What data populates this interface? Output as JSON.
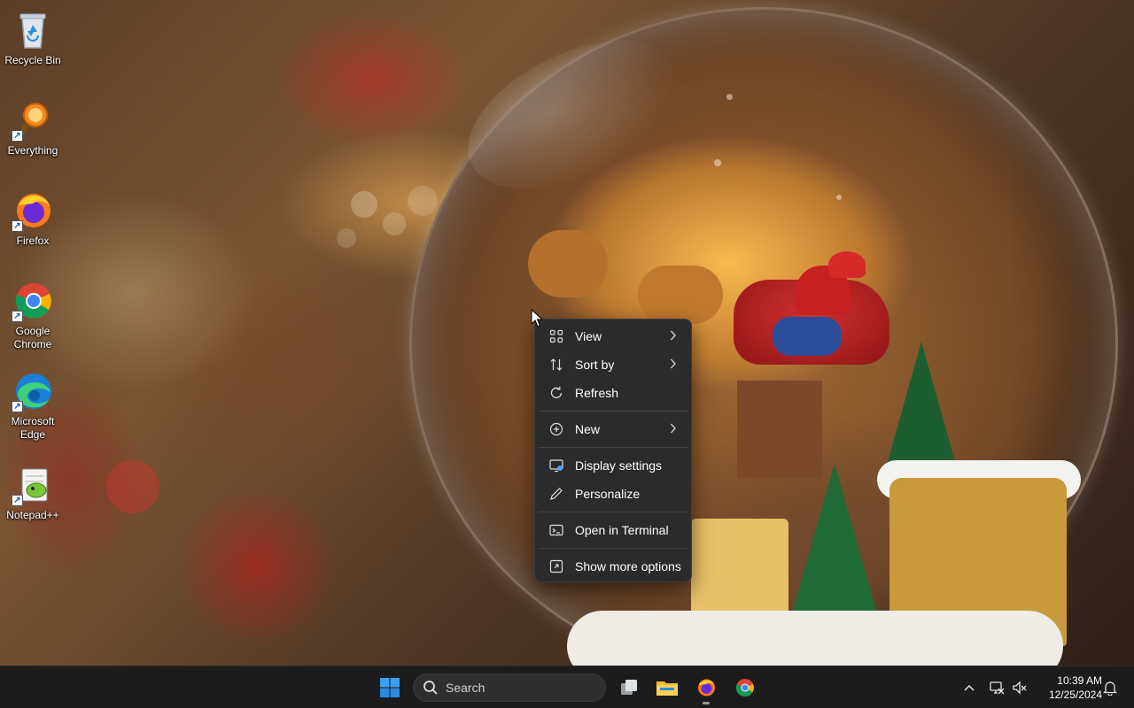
{
  "desktop": {
    "icons": [
      {
        "label": "Recycle Bin",
        "icon": "recycle-bin-icon"
      },
      {
        "label": "Everything",
        "icon": "everything-search-icon"
      },
      {
        "label": "Firefox",
        "icon": "firefox-icon"
      },
      {
        "label": "Google Chrome",
        "icon": "chrome-icon"
      },
      {
        "label": "Microsoft Edge",
        "icon": "edge-icon"
      },
      {
        "label": "Notepad++",
        "icon": "notepad-plus-plus-icon"
      }
    ]
  },
  "context_menu": {
    "items": [
      {
        "label": "View",
        "icon": "view-grid-icon",
        "submenu": true
      },
      {
        "label": "Sort by",
        "icon": "sort-icon",
        "submenu": true
      },
      {
        "label": "Refresh",
        "icon": "refresh-icon",
        "submenu": false
      },
      {
        "label": "New",
        "icon": "new-plus-icon",
        "submenu": true
      },
      {
        "label": "Display settings",
        "icon": "display-settings-icon",
        "submenu": false
      },
      {
        "label": "Personalize",
        "icon": "personalize-pen-icon",
        "submenu": false
      },
      {
        "label": "Open in Terminal",
        "icon": "terminal-icon",
        "submenu": false
      },
      {
        "label": "Show more options",
        "icon": "show-more-options-icon",
        "submenu": false
      }
    ]
  },
  "taskbar": {
    "search_placeholder": "Search",
    "apps": [
      {
        "name": "Start",
        "icon": "windows-start-icon"
      },
      {
        "name": "Task View",
        "icon": "task-view-icon"
      },
      {
        "name": "File Explorer",
        "icon": "file-explorer-icon"
      },
      {
        "name": "Firefox",
        "icon": "firefox-icon",
        "active": true
      },
      {
        "name": "Google Chrome",
        "icon": "chrome-icon"
      }
    ],
    "tray": {
      "time": "10:39 AM",
      "date": "12/25/2024"
    }
  },
  "colors": {
    "menu_bg": "#2b2b2b",
    "taskbar_bg": "#1c1c1c",
    "accent_blue": "#0078d4"
  }
}
